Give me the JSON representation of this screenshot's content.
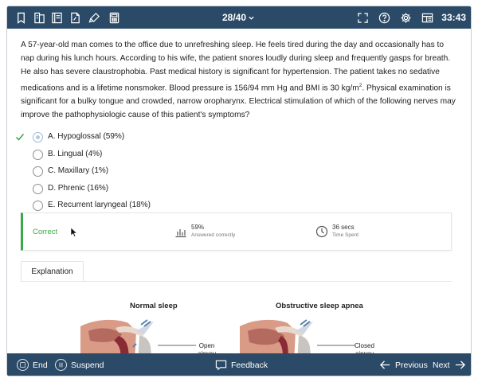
{
  "topbar": {
    "left_icons": [
      "bookmark-icon",
      "lab-values-icon",
      "notes-icon",
      "document-icon",
      "highlighter-icon",
      "calculator-icon"
    ],
    "question_counter": "28/40",
    "right_icons": [
      "fullscreen-icon",
      "help-icon",
      "settings-icon",
      "layout-icon"
    ],
    "timer": "33:43",
    "background_color": "#2a4a67"
  },
  "question": {
    "stem_parts": [
      "A 57-year-old man comes to the office due to unrefreshing sleep.  He feels tired during the day and occasionally has to nap during his lunch hours.  According to his wife, the patient snores loudly during sleep and frequently gasps for breath.  He also has severe claustrophobia.  Past medical history is significant for hypertension.  The patient takes no sedative medications and is a lifetime nonsmoker.  Blood pressure is 156/94 mm Hg and BMI is 30 kg/m",
      "2",
      ".  Physical examination is significant for a bulky tongue and crowded, narrow oropharynx.  Electrical stimulation of which of the following nerves may improve the pathophysiologic cause of this patient's symptoms?"
    ]
  },
  "choices": [
    {
      "label": "A.  Hypoglossal (59%)",
      "selected": true,
      "correct": true
    },
    {
      "label": "B.  Lingual (4%)",
      "selected": false,
      "correct": false
    },
    {
      "label": "C.  Maxillary (1%)",
      "selected": false,
      "correct": false
    },
    {
      "label": "D.  Phrenic (16%)",
      "selected": false,
      "correct": false
    },
    {
      "label": "E.  Recurrent laryngeal (18%)",
      "selected": false,
      "correct": false
    }
  ],
  "result": {
    "status": "Correct",
    "status_color": "#38a845",
    "percent_value": "59%",
    "percent_label": "Answered correctly",
    "time_value": "36 secs",
    "time_label": "Time Spent"
  },
  "explanation": {
    "tab_label": "Explanation",
    "figure_left_title": "Normal sleep",
    "figure_left_label": [
      "Open",
      "airway"
    ],
    "figure_right_title": "Obstructive sleep apnea",
    "figure_right_label": [
      "Closed",
      "airway"
    ]
  },
  "bottombar": {
    "end_label": "End",
    "suspend_label": "Suspend",
    "feedback_label": "Feedback",
    "previous_label": "Previous",
    "next_label": "Next"
  }
}
